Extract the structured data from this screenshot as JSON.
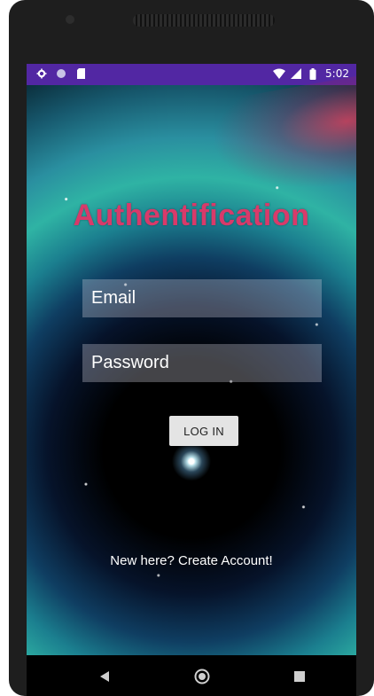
{
  "status_bar": {
    "time": "5:02",
    "icons": [
      "settings-icon",
      "circle-icon",
      "sd-card-icon",
      "wifi-icon",
      "signal-icon",
      "battery-icon"
    ]
  },
  "screen": {
    "title": "Authentification",
    "email": {
      "placeholder": "Email",
      "value": ""
    },
    "password": {
      "placeholder": "Password",
      "value": ""
    },
    "login_button": "LOG IN",
    "create_account_link": "New here? Create Account!"
  },
  "nav_bar": {
    "icons": [
      "back-icon",
      "home-icon",
      "recents-icon"
    ]
  },
  "colors": {
    "status_bar": "#5227a3",
    "title": "#d83a6a",
    "button": "#e4e4e4"
  }
}
